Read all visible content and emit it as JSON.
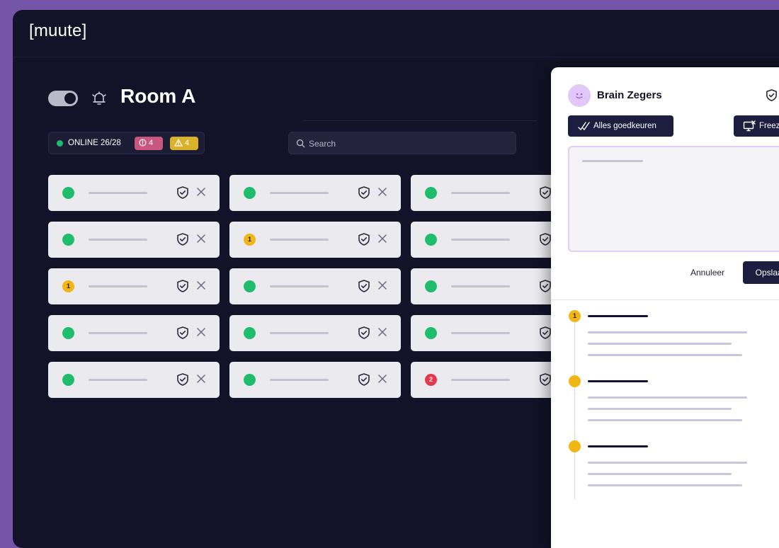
{
  "app": {
    "logo": "[muute]",
    "room": {
      "title": "Room A",
      "enabled": true
    },
    "status": {
      "online_label": "ONLINE 26/28",
      "error_count": "4",
      "warning_count": "4"
    },
    "search": {
      "placeholder": "Search"
    }
  },
  "colors": {
    "accent": "#1d1d40",
    "online": "#1fbd6b",
    "warning": "#f2b614",
    "error": "#e5364c",
    "error_badge": "#c9577d",
    "warning_badge": "#d8b22a"
  },
  "grid": {
    "cards": [
      {
        "status": "green",
        "badge": ""
      },
      {
        "status": "green",
        "badge": ""
      },
      {
        "status": "green",
        "badge": ""
      },
      {
        "status": "green",
        "badge": ""
      },
      {
        "status": "yellow",
        "badge": "1"
      },
      {
        "status": "green",
        "badge": ""
      },
      {
        "status": "yellow",
        "badge": "1"
      },
      {
        "status": "green",
        "badge": ""
      },
      {
        "status": "green",
        "badge": ""
      },
      {
        "status": "green",
        "badge": ""
      },
      {
        "status": "green",
        "badge": ""
      },
      {
        "status": "green",
        "badge": ""
      },
      {
        "status": "green",
        "badge": ""
      },
      {
        "status": "green",
        "badge": ""
      },
      {
        "status": "red",
        "badge": "2"
      }
    ]
  },
  "panel": {
    "user_name": "Brain Zegers",
    "badge": "1",
    "approve_label": "Alles goedkeuren",
    "freeze_label": "Freeze",
    "cancel_label": "Annuleer",
    "save_label": "Opslaan",
    "timeline": [
      {
        "badge": "1"
      },
      {
        "badge": ""
      },
      {
        "badge": ""
      }
    ],
    "add_label": "+"
  }
}
